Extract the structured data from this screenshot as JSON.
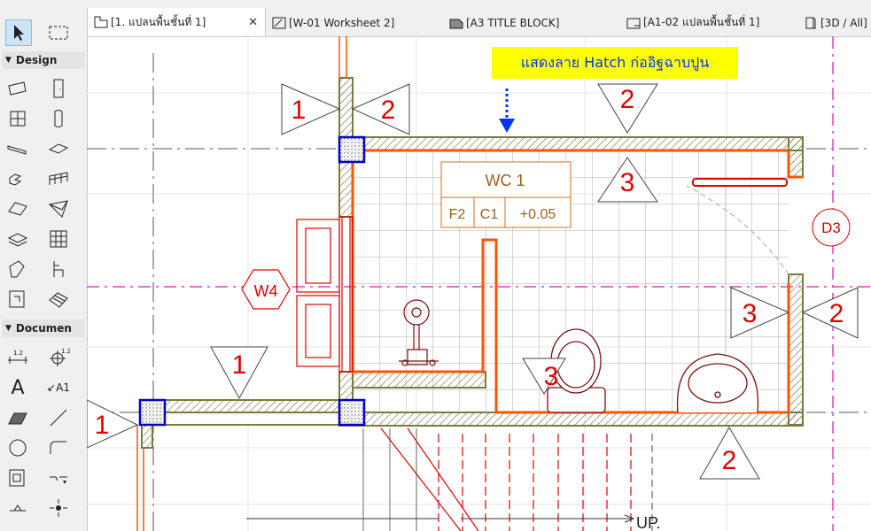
{
  "tabs": [
    {
      "label": "[1. แปลนพื้นชั้นที่ 1]",
      "active": true,
      "close": "✕"
    },
    {
      "label": "[W-01 Worksheet 2]"
    },
    {
      "label": "[A3 TITLE BLOCK]"
    },
    {
      "label": "[A1-02 แปลนพื้นชั้นที่ 1]"
    },
    {
      "label": "[3D / All]"
    }
  ],
  "toolbox": {
    "design_label": "Design",
    "document_label": "Documen",
    "dim_label": "1.2",
    "dim2_label": "1.2",
    "text_tool": "A",
    "label_tool": "A1"
  },
  "annotation": {
    "callout": "แสดงลาย Hatch ก่ออิฐฉาบปูน"
  },
  "room_stamp": {
    "name": "WC 1",
    "floor": "F2",
    "ceiling": "C1",
    "level": "+0.05"
  },
  "markers": {
    "left_top_a": "1",
    "left_top_b": "2",
    "top_mid": "2",
    "mid": "3",
    "right_a": "3",
    "right_b": "2",
    "left_low": "1",
    "edge_left": "1",
    "fixture": "3",
    "bottom": "2",
    "window_tag": "W4",
    "door_tag": "D3",
    "stair_label": "UP."
  },
  "colors": {
    "accent_tab_bg": "#ffffff",
    "callout_bg": "#ffff00",
    "callout_text": "#0033ff",
    "marker_text": "#e00000",
    "wall_finish": "#ff5500",
    "hatch_olive": "#7a7a40",
    "axis_magenta": "#e040c0",
    "column_blue": "#0000cc",
    "stamp_orange": "#d07020"
  }
}
